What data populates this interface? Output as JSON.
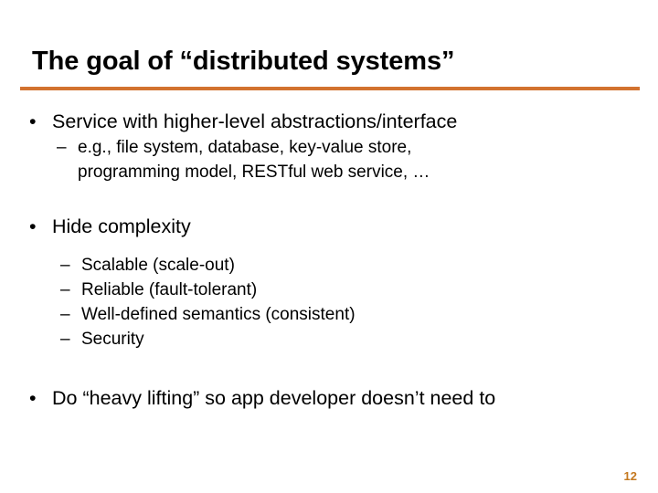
{
  "slide": {
    "title": "The goal of “distributed systems”",
    "page_number": "12",
    "accent_color": "#D2722F",
    "page_number_color": "#C4781F",
    "background_color": "#FFFFFF",
    "text_color": "#000000",
    "bullet_marker": "•",
    "dash_marker": "–",
    "blocks": {
      "b1": {
        "text": "Service with higher-level abstractions/interface",
        "sub": {
          "s1_line1": "e.g., file system, database, key-value store,",
          "s1_line2": "programming model, RESTful web service, …"
        }
      },
      "b2": {
        "text": "Hide complexity",
        "sub": {
          "s1": "Scalable (scale-out)",
          "s2": "Reliable (fault-tolerant)",
          "s3": "Well-defined semantics (consistent)",
          "s4": "Security"
        }
      },
      "b3": {
        "text": "Do “heavy lifting” so app developer doesn’t need to"
      }
    }
  }
}
